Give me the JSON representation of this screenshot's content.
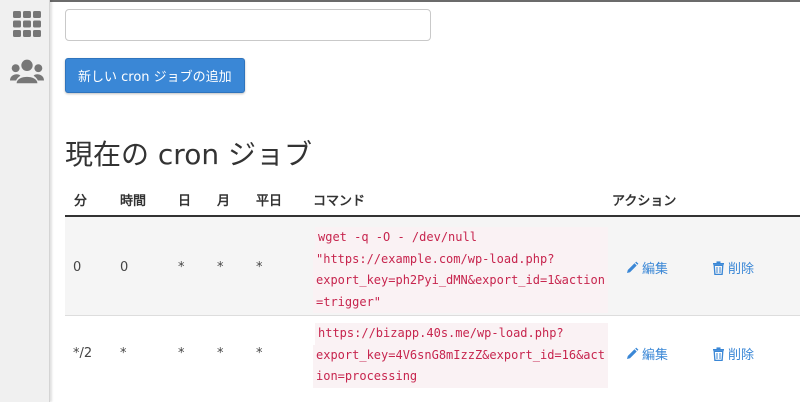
{
  "form": {
    "input_value": "",
    "add_button_label": "新しい cron ジョブの追加"
  },
  "section_title": "現在の cron ジョブ",
  "table": {
    "headers": [
      "分",
      "時間",
      "日",
      "月",
      "平日",
      "コマンド",
      "アクション"
    ],
    "rows": [
      {
        "minute": "0",
        "hour": "0",
        "day": "*",
        "month": "*",
        "weekday": "*",
        "command_lines": [
          "wget -q -O - /dev/null",
          "\"https://example.com/wp-load.php?",
          "export_key=ph2Pyi_dMN&export_id=1&action",
          "=trigger\""
        ],
        "edit_label": "編集",
        "delete_label": "削除"
      },
      {
        "minute": "*/2",
        "hour": "*",
        "day": "*",
        "month": "*",
        "weekday": "*",
        "command_lines": [
          "https://bizapp.40s.me/wp-load.php?",
          "export_key=4V6snG8mIzzZ&export_id=16&act",
          "ion=processing"
        ],
        "edit_label": "編集",
        "delete_label": "削除"
      }
    ]
  },
  "colors": {
    "link": "#3a87d6",
    "button": "#3a87d6",
    "code": "#c7254e"
  },
  "icons": {
    "apps": "grid-icon",
    "users": "users-icon",
    "edit": "pencil-icon",
    "delete": "trash-icon"
  }
}
